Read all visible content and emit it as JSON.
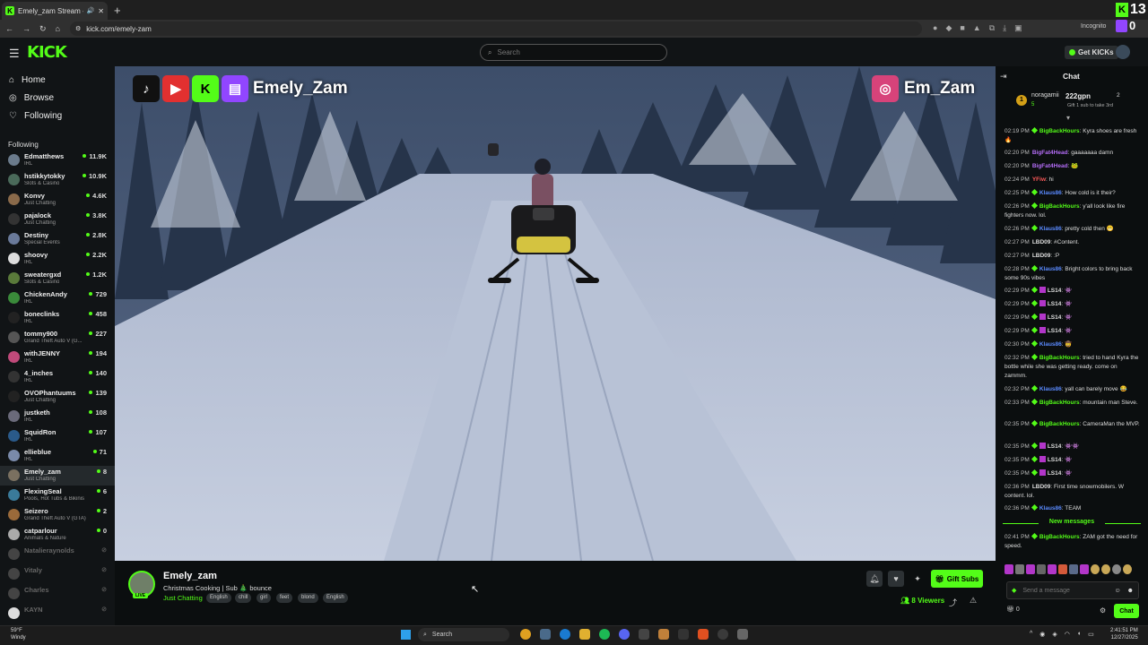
{
  "browser": {
    "tab_title": "Emely_zam Stream - Watch",
    "url": "kick.com/emely-zam",
    "incognito_label": "Incognito",
    "kick_ext_count": "13",
    "twitch_ext_count": "0"
  },
  "header": {
    "logo": "KICK",
    "search_placeholder": "Search",
    "get_kicks": "Get KICKs"
  },
  "nav": {
    "home": "Home",
    "browse": "Browse",
    "following": "Following"
  },
  "following_header": "Following",
  "following": [
    {
      "name": "Edmatthews",
      "category": "IRL",
      "viewers": "11.9K",
      "online": true,
      "avatar": "#6b7b8c"
    },
    {
      "name": "hstikkytokky",
      "category": "Slots & Casino",
      "viewers": "10.9K",
      "online": true,
      "avatar": "#4a6a5a"
    },
    {
      "name": "Konvy",
      "category": "Just Chatting",
      "viewers": "4.6K",
      "online": true,
      "avatar": "#8a6a4a"
    },
    {
      "name": "pajalock",
      "category": "Just Chatting",
      "viewers": "3.8K",
      "online": true,
      "avatar": "#333"
    },
    {
      "name": "Destiny",
      "category": "Special Events",
      "viewers": "2.8K",
      "online": true,
      "avatar": "#6a7a9a"
    },
    {
      "name": "shoovy",
      "category": "IRL",
      "viewers": "2.2K",
      "online": true,
      "avatar": "#ddd"
    },
    {
      "name": "sweatergxd",
      "category": "Slots & Casino",
      "viewers": "1.2K",
      "online": true,
      "avatar": "#5a7a3a"
    },
    {
      "name": "ChickenAndy",
      "category": "IRL",
      "viewers": "729",
      "online": true,
      "avatar": "#3a8a3a"
    },
    {
      "name": "boneclinks",
      "category": "IRL",
      "viewers": "458",
      "online": true,
      "avatar": "#222"
    },
    {
      "name": "tommy900",
      "category": "Grand Theft Auto V (G...",
      "viewers": "227",
      "online": true,
      "avatar": "#555"
    },
    {
      "name": "withJENNY",
      "category": "IRL",
      "viewers": "194",
      "online": true,
      "avatar": "#c04a7a"
    },
    {
      "name": "4_inches",
      "category": "IRL",
      "viewers": "140",
      "online": true,
      "avatar": "#333"
    },
    {
      "name": "OVOPhantuums",
      "category": "Just Chatting",
      "viewers": "139",
      "online": true,
      "avatar": "#222"
    },
    {
      "name": "justketh",
      "category": "IRL",
      "viewers": "108",
      "online": true,
      "avatar": "#6a6a7a"
    },
    {
      "name": "SquidRon",
      "category": "IRL",
      "viewers": "107",
      "online": true,
      "avatar": "#2a5a8a"
    },
    {
      "name": "ellieblue",
      "category": "IRL",
      "viewers": "71",
      "online": true,
      "avatar": "#7a8aaa"
    },
    {
      "name": "Emely_zam",
      "category": "Just Chatting",
      "viewers": "8",
      "online": true,
      "selected": true,
      "avatar": "#7a7060"
    },
    {
      "name": "FlexingSeal",
      "category": "Pools, Hot Tubs & Bikinis",
      "viewers": "6",
      "online": true,
      "avatar": "#3a7a9a"
    },
    {
      "name": "Seizero",
      "category": "Grand Theft Auto V (GTA)",
      "viewers": "2",
      "online": true,
      "avatar": "#9a6a3a"
    },
    {
      "name": "catparlour",
      "category": "Animals & Nature",
      "viewers": "0",
      "online": true,
      "avatar": "#aaa"
    },
    {
      "name": "Natalieraynolds",
      "category": "",
      "viewers": "",
      "online": false,
      "avatar": "#444"
    },
    {
      "name": "Vitaly",
      "category": "",
      "viewers": "",
      "online": false,
      "avatar": "#444"
    },
    {
      "name": "Charles",
      "category": "",
      "viewers": "",
      "online": false,
      "avatar": "#444"
    },
    {
      "name": "KAYN",
      "category": "",
      "viewers": "",
      "online": false,
      "avatar": "#ddd"
    }
  ],
  "overlay": {
    "left_name": "Emely_Zam",
    "right_name": "Em_Zam",
    "icons": [
      "tiktok-icon",
      "youtube-icon",
      "kick-icon",
      "twitch-icon",
      "instagram-icon"
    ]
  },
  "stream": {
    "streamer": "Emely_zam",
    "live_badge": "LIVE",
    "title": "Christmas Cooking | Sub 🎄 bounce",
    "category": "Just Chatting",
    "tags": [
      "English",
      "chill",
      "girl",
      "feet",
      "blond",
      "English"
    ],
    "viewers": "8 Viewers",
    "gift_subs": "Gift Subs"
  },
  "chat": {
    "title": "Chat",
    "pinned": {
      "user": "noragamii",
      "amount": "222gpn",
      "rank": "1",
      "count_left": "5",
      "count_right": "2",
      "text": "Gift 1 sub to take 3rd"
    },
    "messages": [
      {
        "time": "02:19 PM",
        "user": "BigBackHours",
        "color": "#53fc18",
        "badge": true,
        "sub": false,
        "text": "Kyra shoes are fresh",
        "emote": "🔥"
      },
      {
        "time": "02:20 PM",
        "user": "BigFat4Head",
        "color": "#b36cf5",
        "badge": false,
        "sub": false,
        "text": "gaaaaaaa damn",
        "emote": ""
      },
      {
        "time": "02:20 PM",
        "user": "BigFat4Head",
        "color": "#b36cf5",
        "badge": false,
        "sub": false,
        "text": "",
        "emote": "🐸"
      },
      {
        "time": "02:24 PM",
        "user": "YFiw",
        "color": "#ff5a5a",
        "badge": false,
        "sub": false,
        "text": "hi",
        "emote": ""
      },
      {
        "time": "02:25 PM",
        "user": "Klaus86",
        "color": "#5a8aff",
        "badge": true,
        "sub": false,
        "text": "How cold is it their?",
        "emote": ""
      },
      {
        "time": "02:26 PM",
        "user": "BigBackHours",
        "color": "#53fc18",
        "badge": true,
        "sub": false,
        "text": "y'all look like fire fighters now. lol.",
        "emote": ""
      },
      {
        "time": "02:26 PM",
        "user": "Klaus86",
        "color": "#5a8aff",
        "badge": true,
        "sub": false,
        "text": "pretty cold then",
        "emote": "😬"
      },
      {
        "time": "02:27 PM",
        "user": "LBD09",
        "color": "#dddddd",
        "badge": false,
        "sub": false,
        "text": "#Content.",
        "emote": ""
      },
      {
        "time": "02:27 PM",
        "user": "LBD09",
        "color": "#dddddd",
        "badge": false,
        "sub": false,
        "text": ":P",
        "emote": ""
      },
      {
        "time": "02:28 PM",
        "user": "Klaus86",
        "color": "#5a8aff",
        "badge": true,
        "sub": false,
        "text": "Bright colors to bring back some 90s vibes",
        "emote": ""
      },
      {
        "time": "02:29 PM",
        "user": "LS14",
        "color": "#dddddd",
        "badge": true,
        "sub": true,
        "text": "",
        "emote": "👾"
      },
      {
        "time": "02:29 PM",
        "user": "LS14",
        "color": "#dddddd",
        "badge": true,
        "sub": true,
        "text": "",
        "emote": "👾"
      },
      {
        "time": "02:29 PM",
        "user": "LS14",
        "color": "#dddddd",
        "badge": true,
        "sub": true,
        "text": "",
        "emote": "👾"
      },
      {
        "time": "02:29 PM",
        "user": "LS14",
        "color": "#dddddd",
        "badge": true,
        "sub": true,
        "text": "",
        "emote": "👾"
      },
      {
        "time": "02:30 PM",
        "user": "Klaus86",
        "color": "#5a8aff",
        "badge": true,
        "sub": false,
        "text": "",
        "emote": "🤠"
      },
      {
        "time": "02:32 PM",
        "user": "BigBackHours",
        "color": "#53fc18",
        "badge": true,
        "sub": false,
        "text": "tried to hand Kyra the bottle while she was getting ready. come on zammm.",
        "emote": ""
      },
      {
        "time": "02:32 PM",
        "user": "Klaus86",
        "color": "#5a8aff",
        "badge": true,
        "sub": false,
        "text": "yall can barely move",
        "emote": "😂"
      },
      {
        "time": "02:33 PM",
        "user": "BigBackHours",
        "color": "#53fc18",
        "badge": true,
        "sub": false,
        "text": "mountain man Steve.",
        "emote": ""
      },
      {
        "time": "02:35 PM",
        "user": "BigBackHours",
        "color": "#53fc18",
        "badge": true,
        "sub": false,
        "text": "CameraMan the MVP.",
        "emote": ""
      },
      {
        "time": "02:35 PM",
        "user": "LS14",
        "color": "#dddddd",
        "badge": true,
        "sub": true,
        "text": "",
        "emote": "👾👾"
      },
      {
        "time": "02:35 PM",
        "user": "LS14",
        "color": "#dddddd",
        "badge": true,
        "sub": true,
        "text": "",
        "emote": "👾"
      },
      {
        "time": "02:35 PM",
        "user": "LS14",
        "color": "#dddddd",
        "badge": true,
        "sub": true,
        "text": "",
        "emote": "👾"
      },
      {
        "time": "02:36 PM",
        "user": "LBD09",
        "color": "#dddddd",
        "badge": false,
        "sub": false,
        "text": "First time snowmobilers. W content. lol.",
        "emote": ""
      },
      {
        "time": "02:36 PM",
        "user": "Klaus86",
        "color": "#5a8aff",
        "badge": true,
        "sub": false,
        "text": "TEAM",
        "emote": ""
      }
    ],
    "new_messages": "New messages",
    "after_new": {
      "time": "02:41 PM",
      "user": "BigBackHours",
      "color": "#53fc18",
      "text": "ZAM got the need for speed."
    },
    "send_placeholder": "Send a message",
    "kicks_count": "0",
    "chat_button": "Chat"
  },
  "taskbar": {
    "temp": "59°F",
    "weather": "Windy",
    "search": "Search",
    "time": "2:41:51 PM",
    "date": "12/27/2025"
  },
  "colors": {
    "accent": "#53fc18",
    "bg": "#0b0e0f",
    "panel": "#111416"
  }
}
